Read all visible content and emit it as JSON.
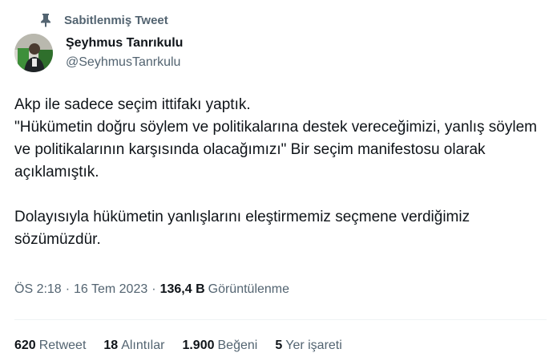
{
  "pinned": {
    "label": "Sabitlenmiş Tweet",
    "icon": "pin-icon"
  },
  "author": {
    "display_name": "Şeyhmus Tanrıkulu",
    "handle": "@SeyhmusTanrkulu",
    "avatar_icon": "avatar"
  },
  "tweet": {
    "line1": "Akp ile sadece seçim ittifakı yaptık.",
    "line2": "\"Hükümetin doğru söylem ve politikalarına destek vereceğimizi, yanlış söylem ve politikalarının karşısında olacağımızı\" Bir seçim manifestosu olarak açıklamıştık.",
    "line3": "Dolayısıyla hükümetin yanlışlarını eleştirmemiz seçmene verdiğimiz sözümüzdür."
  },
  "meta": {
    "time": "ÖS 2:18",
    "separator": "·",
    "date": "16 Tem 2023",
    "views_count": "136,4 B",
    "views_label": "Görüntülenme"
  },
  "stats": {
    "retweets_count": "620",
    "retweets_label": "Retweet",
    "quotes_count": "18",
    "quotes_label": "Alıntılar",
    "likes_count": "1.900",
    "likes_label": "Beğeni",
    "bookmarks_count": "5",
    "bookmarks_label": "Yer işareti"
  },
  "colors": {
    "primary_text": "#0f1419",
    "secondary_text": "#536471",
    "divider": "#eff3f4",
    "avatar_green": "#3e8f3a"
  }
}
